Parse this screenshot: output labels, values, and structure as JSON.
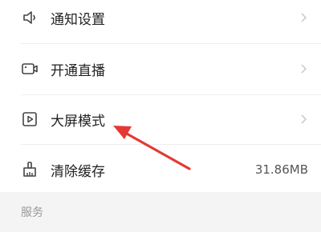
{
  "menu": {
    "items": [
      {
        "label": "通知设置",
        "icon": "speaker-icon",
        "has_chevron": true
      },
      {
        "label": "开通直播",
        "icon": "camera-icon",
        "has_chevron": true
      },
      {
        "label": "大屏模式",
        "icon": "play-icon",
        "has_chevron": true
      },
      {
        "label": "清除缓存",
        "icon": "broom-icon",
        "value": "31.86MB",
        "has_chevron": false
      }
    ]
  },
  "section": {
    "label": "服务"
  },
  "annotation": {
    "color": "#e53935",
    "icon": "red-arrow-icon"
  },
  "colors": {
    "text": "#222222",
    "muted": "#999999",
    "chevron": "#c7c7c7",
    "section_bg": "#f4f4f4"
  }
}
